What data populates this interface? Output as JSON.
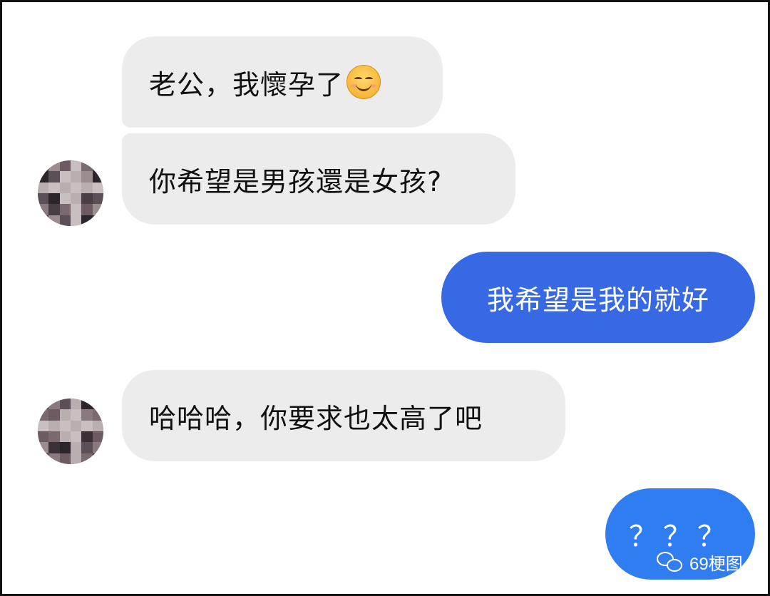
{
  "chat": {
    "messages": [
      {
        "direction": "incoming",
        "text": "老公，我懷孕了",
        "emoji": "smiling-face-emoji"
      },
      {
        "direction": "incoming",
        "text": "你希望是男孩還是女孩?"
      },
      {
        "direction": "outgoing",
        "text": "我希望是我的就好"
      },
      {
        "direction": "incoming",
        "text": "哈哈哈，你要求也太高了吧"
      },
      {
        "direction": "outgoing",
        "text": "？？？"
      }
    ]
  },
  "watermark": {
    "text": "69梗图",
    "icon": "wechat-icon"
  },
  "colors": {
    "incoming_bubble": "#ececed",
    "outgoing_bubble_1": "#3669e3",
    "outgoing_bubble_2": "#2f7df0",
    "background": "#ffffff"
  }
}
